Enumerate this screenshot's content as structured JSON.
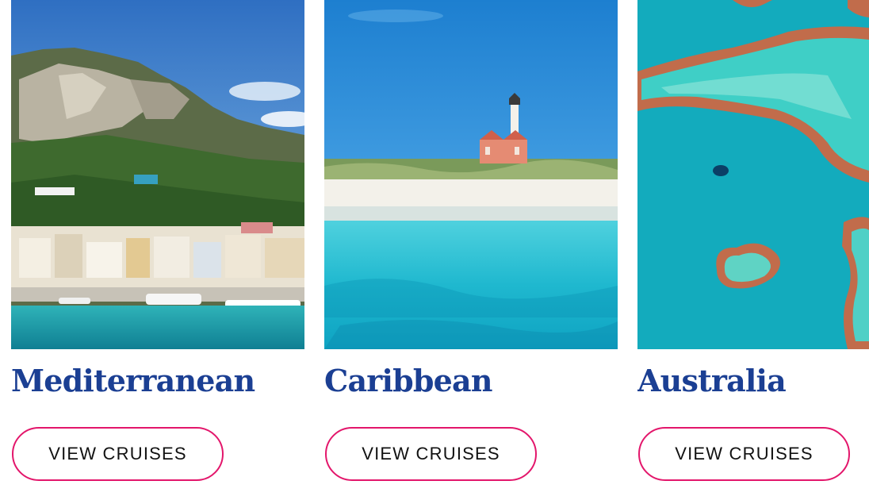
{
  "cards": [
    {
      "title": "Mediterranean",
      "cta": "VIEW CRUISES"
    },
    {
      "title": "Caribbean",
      "cta": "VIEW CRUISES"
    },
    {
      "title": "Australia",
      "cta": "VIEW CRUISES"
    }
  ],
  "colors": {
    "title": "#1b3f93",
    "button_border": "#e3166b",
    "button_text": "#111111"
  }
}
